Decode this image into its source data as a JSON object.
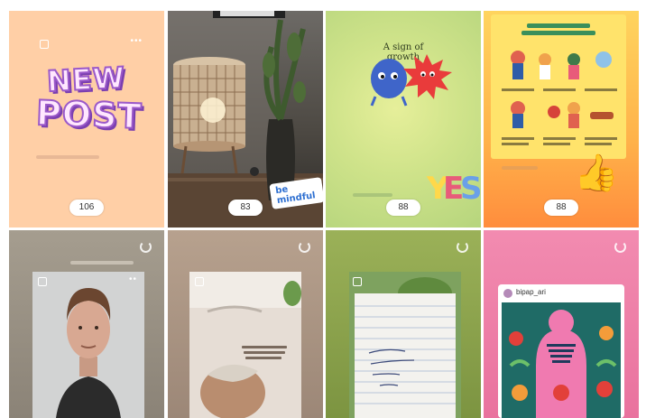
{
  "tiles": [
    {
      "id": "tile-1",
      "text_line1": "NEW",
      "text_line2": "POST",
      "views": "106"
    },
    {
      "id": "tile-2",
      "sticker": "be mindful",
      "views": "83"
    },
    {
      "id": "tile-3",
      "title_line1": "A sign of",
      "title_line2": "growth",
      "views": "88"
    },
    {
      "id": "tile-4",
      "views": "88"
    },
    {
      "id": "tile-5"
    },
    {
      "id": "tile-6"
    },
    {
      "id": "tile-7"
    },
    {
      "id": "tile-8",
      "account_name": "bipap_ari"
    }
  ]
}
